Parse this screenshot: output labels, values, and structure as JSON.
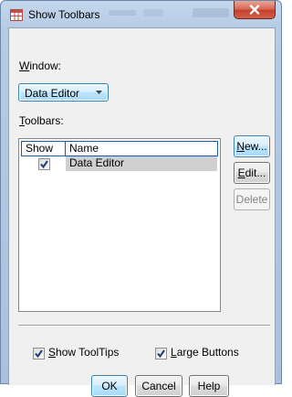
{
  "window": {
    "title": "Show Toolbars",
    "close_icon": "close-icon",
    "app_icon": "spss-grid-icon"
  },
  "window_section": {
    "label_accel": "W",
    "label_rest": "indow:",
    "selected": "Data Editor"
  },
  "toolbars_section": {
    "label_accel": "T",
    "label_rest": "oolbars:",
    "columns": [
      "Show",
      "Name"
    ],
    "rows": [
      {
        "show": true,
        "name": "Data Editor"
      }
    ]
  },
  "side_buttons": {
    "new_accel": "N",
    "new_rest": "ew...",
    "edit_accel": "E",
    "edit_rest": "dit...",
    "delete": "Delete"
  },
  "options": {
    "show_tooltips_accel": "S",
    "show_tooltips_rest": "how ToolTips",
    "show_tooltips_checked": true,
    "large_buttons_accel": "L",
    "large_buttons_rest": "arge Buttons",
    "large_buttons_checked": true
  },
  "footer": {
    "ok": "OK",
    "cancel": "Cancel",
    "help": "Help"
  },
  "colors": {
    "frame": "#b6cce5",
    "close_button": "#c4402c",
    "selection": "#cfcfcf",
    "header_border": "#1a5aa8"
  }
}
